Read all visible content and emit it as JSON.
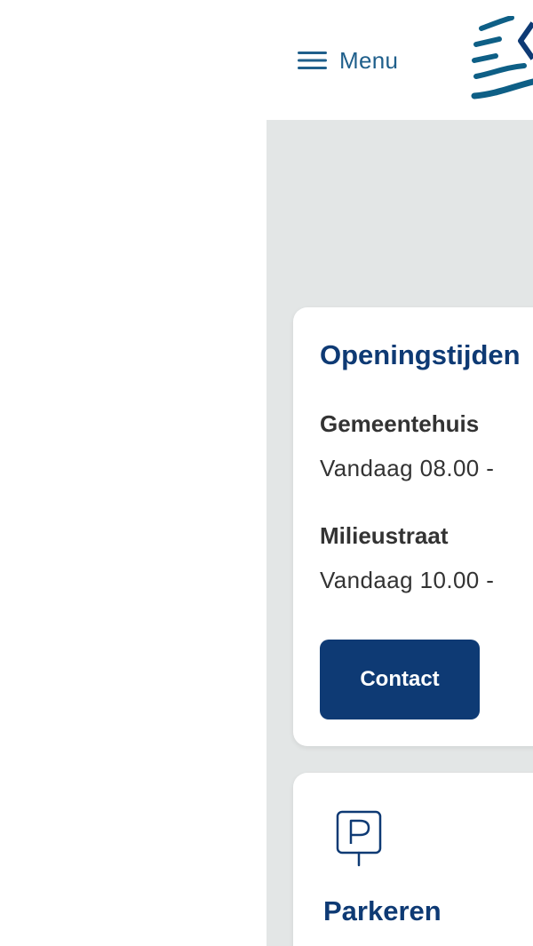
{
  "header": {
    "menu_label": "Menu"
  },
  "opening_hours": {
    "title": "Openingstijden",
    "locations": [
      {
        "name": "Gemeentehuis",
        "hours": "Vandaag 08.00 - "
      },
      {
        "name": "Milieustraat",
        "hours": "Vandaag 10.00 - "
      }
    ],
    "contact_label": "Contact"
  },
  "parking": {
    "title": "Parkeren"
  },
  "colors": {
    "brand_dark": "#0e3a74",
    "brand_light": "#1f5f8b",
    "content_bg": "#e3e6e6"
  }
}
